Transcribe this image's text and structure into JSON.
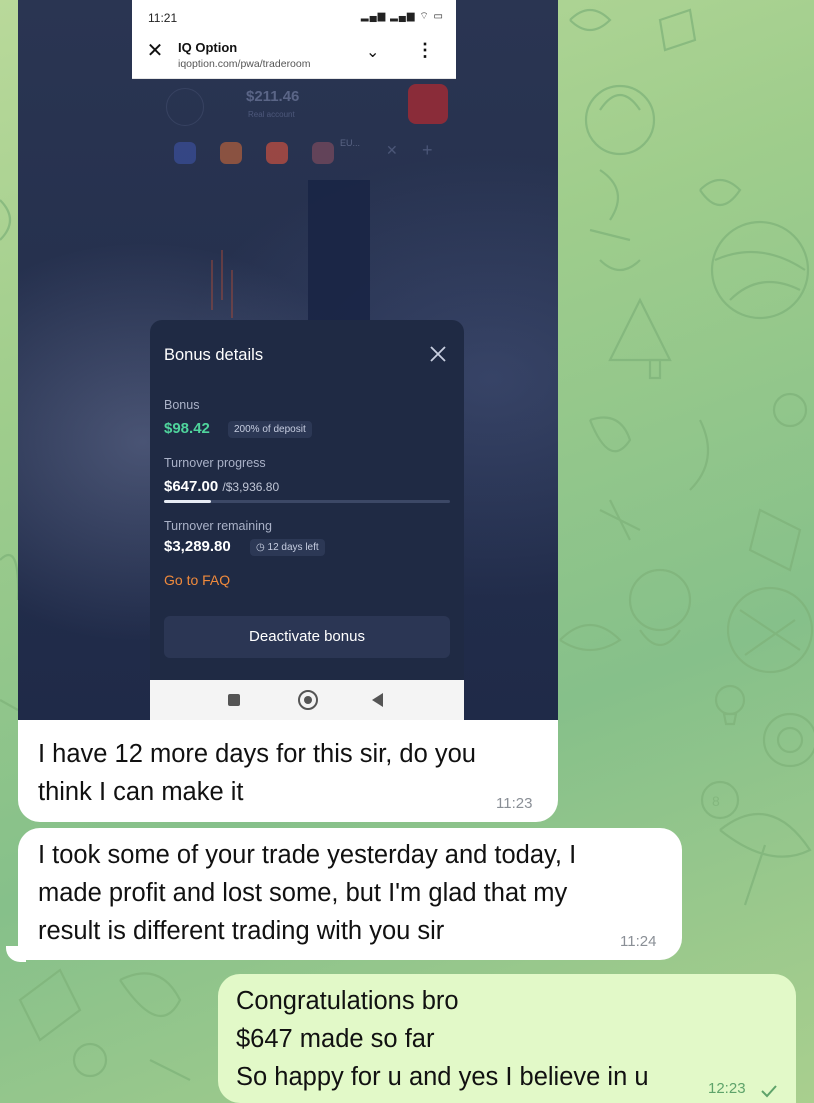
{
  "screenshot": {
    "status_time": "11:21",
    "app_title": "IQ Option",
    "url": "iqoption.com/pwa/traderoom",
    "balance": "$211.46",
    "balance_sub": "Real account",
    "asset_label": "EU...",
    "modal": {
      "title": "Bonus details",
      "bonus_label": "Bonus",
      "bonus_value": "$98.42",
      "bonus_tag": "200% of deposit",
      "turnover_label": "Turnover progress",
      "turnover_value": "$647.00",
      "turnover_total": "/$3,936.80",
      "turnover_fraction": 0.164,
      "remaining_label": "Turnover remaining",
      "remaining_value": "$3,289.80",
      "days_left": "12 days left",
      "faq_link": "Go to FAQ",
      "deactivate_label": "Deactivate bonus"
    }
  },
  "messages": [
    {
      "direction": "incoming",
      "lines": [
        "I have 12 more days for this sir, do you",
        "think I can make it"
      ],
      "time": "11:23"
    },
    {
      "direction": "incoming",
      "lines": [
        "I took some of your trade yesterday and today, I",
        "made profit and lost some, but I'm glad that my",
        "result is different trading with you sir"
      ],
      "time": "11:24"
    },
    {
      "direction": "outgoing",
      "lines": [
        "Congratulations bro",
        "$647 made so far",
        "So happy for u and yes I believe in u"
      ],
      "time": "12:23",
      "status": "sent-check-icon"
    }
  ]
}
